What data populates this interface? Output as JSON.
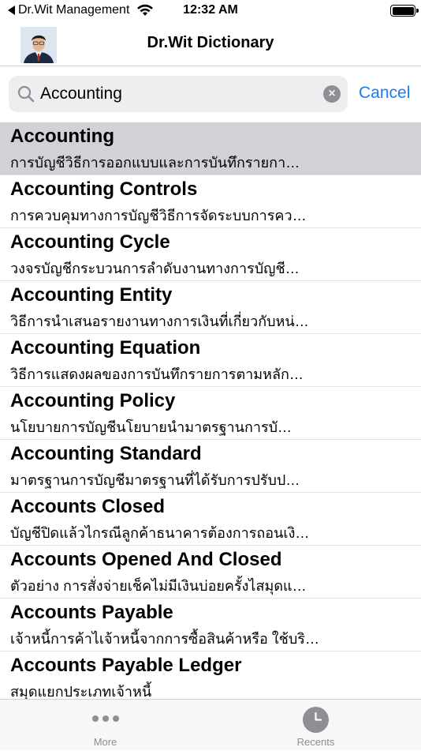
{
  "status_bar": {
    "back_app": "Dr.Wit Management",
    "time": "12:32 AM"
  },
  "nav": {
    "title": "Dr.Wit Dictionary"
  },
  "search": {
    "value": "Accounting",
    "cancel_label": "Cancel"
  },
  "results": [
    {
      "term": "Accounting",
      "definition": "การบัญชีวิธีการออกแบบและการบันทึกรายกา…"
    },
    {
      "term": "Accounting Controls",
      "definition": "การควบคุมทางการบัญชีวิธีการจัดระบบการคว…"
    },
    {
      "term": "Accounting Cycle",
      "definition": "วงจรบัญชีกระบวนการลำดับงานทางการบัญชี…"
    },
    {
      "term": "Accounting Entity",
      "definition": "วิธีการนำเสนอรายงานทางการเงินที่เกี่ยวกับหน่…"
    },
    {
      "term": "Accounting Equation",
      "definition": "วิธีการแสดงผลของการบันทึกรายการตามหลัก…"
    },
    {
      "term": "Accounting Policy",
      "definition": "นโยบายการบัญชีนโยบายนำมาตรฐานการบั…"
    },
    {
      "term": "Accounting Standard",
      "definition": "มาตรฐานการบัญชีมาตรฐานที่ได้รับการปรับป…"
    },
    {
      "term": "Accounts Closed",
      "definition": "บัญชีปิดแล้วไกรณีลูกค้าธนาคารต้องการถอนเงิ…"
    },
    {
      "term": "Accounts Opened And Closed",
      "definition": "ตัวอย่าง การสั่งจ่ายเช็คไม่มีเงินบ่อยครั้งไสมุดแ…"
    },
    {
      "term": "Accounts Payable",
      "definition": "เจ้าหนี้การค้าไเจ้าหนี้จากการซื้อสินค้าหรือ ใช้บริ…"
    },
    {
      "term": "Accounts Payable Ledger",
      "definition": "สมุดแยกประเภทเจ้าหนี้"
    }
  ],
  "tab_bar": {
    "more_label": "More",
    "recents_label": "Recents"
  },
  "icons": {
    "back": "back-arrow-icon",
    "wifi": "wifi-icon",
    "battery": "battery-icon",
    "search": "search-icon",
    "clear": "clear-icon",
    "more": "more-icon",
    "recents": "clock-icon"
  },
  "colors": {
    "accent": "#1a7cf2",
    "selected_row": "#d1d1d6",
    "tab_inactive": "#8e8e93"
  }
}
